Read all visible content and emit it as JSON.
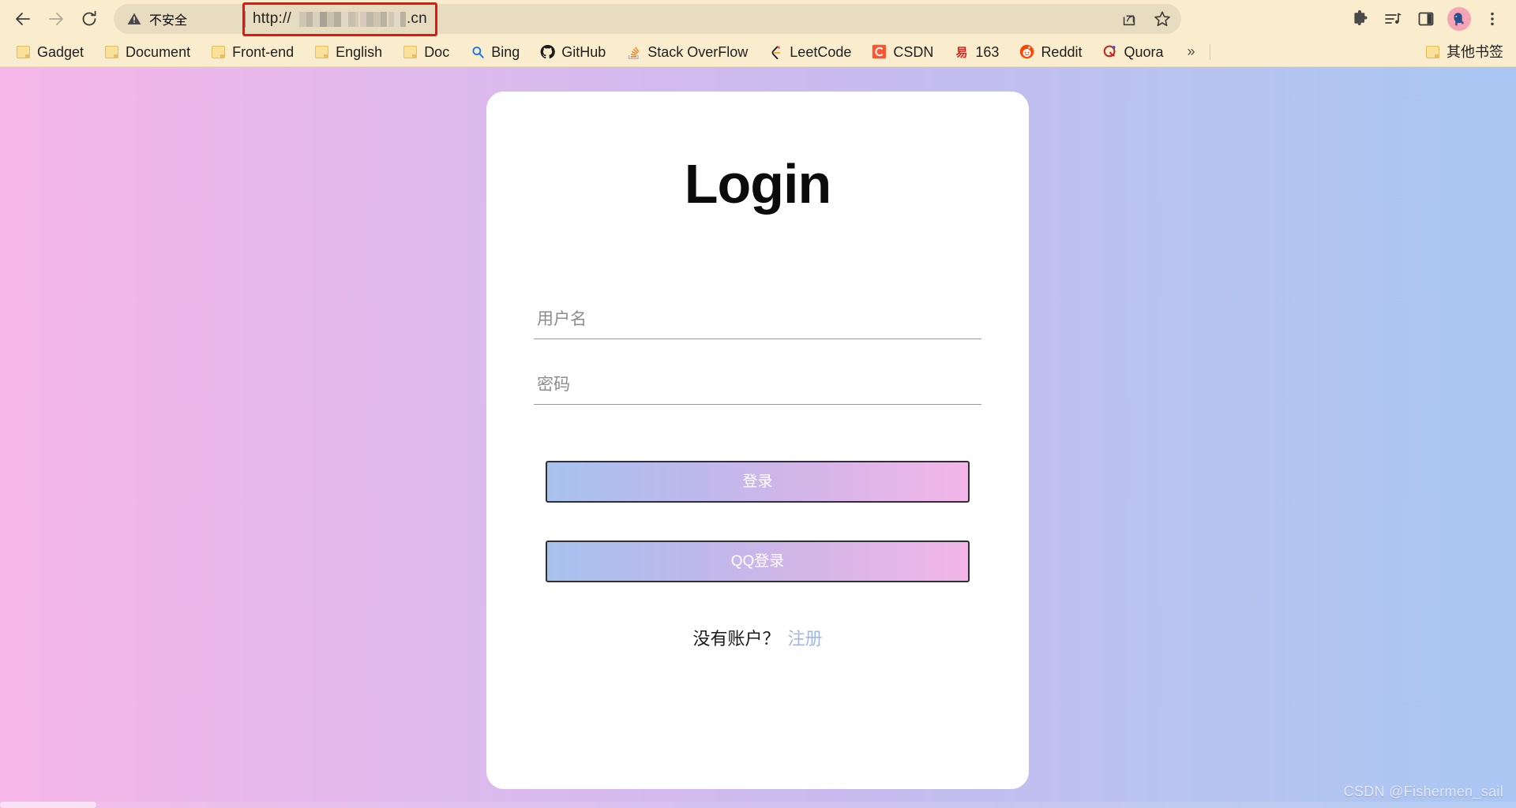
{
  "browser": {
    "nav": {
      "back_icon": "arrow-left-icon",
      "forward_icon": "arrow-right-icon",
      "reload_icon": "reload-icon"
    },
    "omnibox": {
      "security_icon": "warning-triangle-icon",
      "security_label": "不安全",
      "url_scheme": "http://",
      "url_tld": ".cn",
      "url_redacted": true,
      "highlight_color": "#ee1111"
    },
    "toolbar_right": [
      {
        "name": "share-icon",
        "label": "Share"
      },
      {
        "name": "star-icon",
        "label": "Bookmark this tab"
      },
      {
        "name": "puzzle-icon",
        "label": "Extensions"
      },
      {
        "name": "media-playlist-icon",
        "label": "Media"
      },
      {
        "name": "side-panel-icon",
        "label": "Side panel"
      },
      {
        "name": "profile-avatar",
        "label": "Profile"
      },
      {
        "name": "three-dot-menu-icon",
        "label": "Customize and control"
      }
    ],
    "bookmarks": [
      {
        "label": "Gadget",
        "icon": "folder-icon"
      },
      {
        "label": "Document",
        "icon": "folder-icon"
      },
      {
        "label": "Front-end",
        "icon": "folder-icon"
      },
      {
        "label": "English",
        "icon": "folder-icon"
      },
      {
        "label": "Doc",
        "icon": "folder-icon"
      },
      {
        "label": "Bing",
        "icon": "bing-icon"
      },
      {
        "label": "GitHub",
        "icon": "github-icon"
      },
      {
        "label": "Stack OverFlow",
        "icon": "stackoverflow-icon"
      },
      {
        "label": "LeetCode",
        "icon": "leetcode-icon"
      },
      {
        "label": "CSDN",
        "icon": "csdn-icon"
      },
      {
        "label": "163",
        "icon": "netease-icon"
      },
      {
        "label": "Reddit",
        "icon": "reddit-icon"
      },
      {
        "label": "Quora",
        "icon": "quora-icon"
      }
    ],
    "overflow_label": "»",
    "other_bookmarks": {
      "label": "其他书签",
      "icon": "folder-icon"
    }
  },
  "page": {
    "background_gradient": [
      "#f7b6e8",
      "#c9bbef",
      "#a9c6f2"
    ],
    "card": {
      "title": "Login",
      "fields": [
        {
          "name": "username",
          "placeholder": "用户名",
          "value": "",
          "type": "text"
        },
        {
          "name": "password",
          "placeholder": "密码",
          "value": "",
          "type": "password"
        }
      ],
      "buttons": [
        {
          "name": "login",
          "label": "登录",
          "gradient": [
            "#a8c2ee",
            "#f3b6e8"
          ]
        },
        {
          "name": "qq-login",
          "label": "QQ登录",
          "gradient": [
            "#a8c2ee",
            "#f3b6e8"
          ]
        }
      ],
      "signup": {
        "question": "没有账户？",
        "link_label": "注册",
        "link_color": "#9fb8e8"
      }
    },
    "watermark": "CSDN @Fishermen_sail"
  }
}
